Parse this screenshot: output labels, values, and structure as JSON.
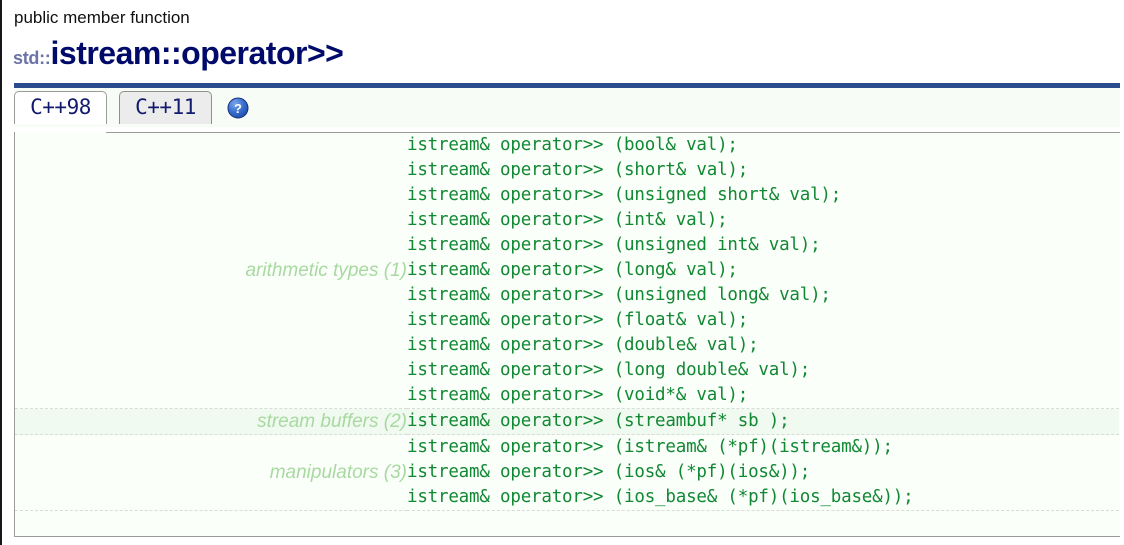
{
  "header": {
    "kicker": "public member function",
    "namespace": "std::",
    "name": "istream::operator>>"
  },
  "tabs": [
    {
      "label": "C++98",
      "active": true
    },
    {
      "label": "C++11",
      "active": false
    }
  ],
  "help": {
    "icon": "help-question-icon",
    "glyph": "?"
  },
  "colors": {
    "title_rule": "#2a4b8d",
    "title_text": "#000a6b",
    "namespace_text": "#6b73a8",
    "code_text": "#118833",
    "group_label_text": "#a8d9a0",
    "panel_background": "#fbfffa",
    "row_stripe": "#f1faf0",
    "tab_active_background": "#ffffff",
    "tab_inactive_background": "#ececec",
    "border": "#9b9c98"
  },
  "signature_groups": [
    {
      "label": "arithmetic types (1)",
      "stripe": "even",
      "signatures": [
        "istream& operator>> (bool& val);",
        "istream& operator>> (short& val);",
        "istream& operator>> (unsigned short& val);",
        "istream& operator>> (int& val);",
        "istream& operator>> (unsigned int& val);",
        "istream& operator>> (long& val);",
        "istream& operator>> (unsigned long& val);",
        "istream& operator>> (float& val);",
        "istream& operator>> (double& val);",
        "istream& operator>> (long double& val);",
        "istream& operator>> (void*& val);"
      ]
    },
    {
      "label": "stream buffers (2)",
      "stripe": "odd",
      "signatures": [
        "istream& operator>> (streambuf* sb );"
      ]
    },
    {
      "label": "manipulators (3)",
      "stripe": "even",
      "signatures": [
        "istream& operator>> (istream& (*pf)(istream&));",
        "istream& operator>> (ios& (*pf)(ios&));",
        "istream& operator>> (ios_base& (*pf)(ios_base&));"
      ]
    }
  ]
}
